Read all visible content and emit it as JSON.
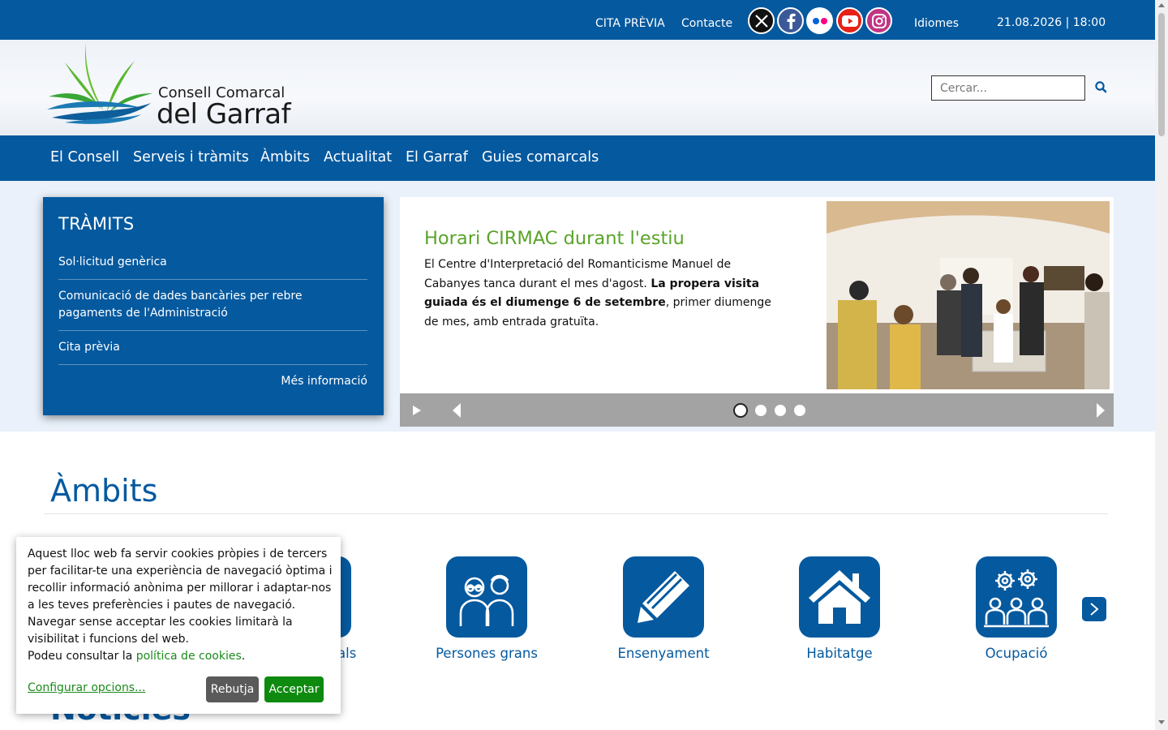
{
  "topbar": {
    "cita_previa": "CITA PRÈVIA",
    "contacte": "Contacte",
    "social": [
      "x-icon",
      "facebook-icon",
      "flickr-icon",
      "youtube-icon",
      "instagram-icon"
    ],
    "idiomes": "Idiomes",
    "datetime": "21.08.2026 | 18:00"
  },
  "header": {
    "logo_line1": "Consell Comarcal",
    "logo_line2": "del Garraf",
    "search_placeholder": "Cercar..."
  },
  "nav": {
    "items": [
      "El Consell",
      "Serveis i tràmits",
      "Àmbits",
      "Actualitat",
      "El Garraf",
      "Guies comarcals"
    ]
  },
  "tramits": {
    "title": "TRÀMITS",
    "links": [
      "Sol·licitud genèrica",
      "Comunicació de dades bancàries per rebre pagaments de l'Administració",
      "Cita prèvia"
    ],
    "more": "Més informació"
  },
  "slider": {
    "title": "Horari CIRMAC durant l'estiu",
    "text_part1": "El Centre d'Interpretació del Romanticisme Manuel de Cabanyes tanca durant el mes d'agost. ",
    "text_bold": "La propera visita guiada és el diumenge 6 de setembre",
    "text_part2": ", primer diumenge de mes, amb entrada gratuïta.",
    "slides_count": 4,
    "active_slide": 1
  },
  "ambits": {
    "title": "Àmbits",
    "partial_label": "als",
    "items": [
      {
        "label": "Persones grans",
        "icon": "elderly-couple-icon"
      },
      {
        "label": "Ensenyament",
        "icon": "pencil-icon"
      },
      {
        "label": "Habitatge",
        "icon": "house-icon"
      },
      {
        "label": "Ocupació",
        "icon": "workers-gears-icon"
      }
    ]
  },
  "noticies": {
    "title": "Notícies"
  },
  "cookie": {
    "text": "Aquest lloc web fa servir cookies pròpies i de tercers per facilitar-te una experiència de navegació òptima i recollir informació anònima per millorar i adaptar-nos a les teves preferències i pautes de navegació. Navegar sense acceptar les cookies limitarà la visibilitat i funcions del web.",
    "policy_prefix": "Podeu consultar la ",
    "policy_link": "política de cookies",
    "policy_suffix": ".",
    "configure": "Configurar opcions...",
    "reject": "Rebutja",
    "accept": "Acceptar"
  },
  "colors": {
    "primary": "#05599f",
    "slide_title": "#5aa32a",
    "accept": "#0e8a0e",
    "reject": "#5a5a5a"
  }
}
